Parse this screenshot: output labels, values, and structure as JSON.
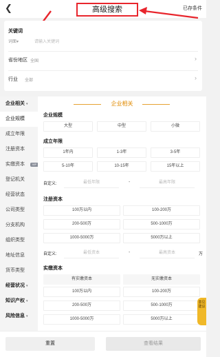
{
  "header": {
    "back_icon": "chevron-left",
    "back_glyph": "❮",
    "title": "高级搜索",
    "saved_conditions": "已存条件",
    "highlight_color": "#e8252c"
  },
  "search": {
    "keyword_label": "关键词",
    "scope": "词面",
    "scope_caret": "▾",
    "placeholder": "请输入关键词",
    "region_label": "省份地区",
    "region_value": "全国",
    "industry_label": "行业",
    "industry_value": "全部",
    "chevron": "›"
  },
  "sidebar": {
    "caret": "▾",
    "vip_badge": "VIP",
    "items": [
      {
        "label": "企业相关",
        "group": true
      },
      {
        "label": "企业规模"
      },
      {
        "label": "成立年限"
      },
      {
        "label": "注册资本"
      },
      {
        "label": "实缴资本"
      },
      {
        "label": "登记机关"
      },
      {
        "label": "经营状态"
      },
      {
        "label": "公司类型"
      },
      {
        "label": "分支机构"
      },
      {
        "label": "组织类型"
      },
      {
        "label": "地址信息"
      },
      {
        "label": "货币类型"
      },
      {
        "label": "经营状况",
        "group": true
      },
      {
        "label": "知识产权",
        "group": true
      },
      {
        "label": "风险信息",
        "group": true
      }
    ]
  },
  "content": {
    "section_title": "企业相关",
    "accent_color": "#e08a00",
    "scale": {
      "title": "企业规模",
      "options": [
        "大型",
        "中型",
        "小微"
      ]
    },
    "years": {
      "title": "成立年限",
      "options": [
        "1年内",
        "1-3年",
        "3-5年",
        "5-10年",
        "10-15年",
        "15年以上"
      ],
      "custom_label": "自定义:",
      "min_placeholder": "最低年限",
      "dash": "-",
      "max_placeholder": "最高年限"
    },
    "registered_capital": {
      "title": "注册资本",
      "options": [
        "100万以内",
        "100-200万",
        "200-500万",
        "500-1000万",
        "1000-5000万",
        "5000万以上"
      ],
      "custom_label": "自定义:",
      "min_placeholder": "最低资本",
      "dash": "-",
      "max_placeholder": "最高资本",
      "unit": "万"
    },
    "paid_capital": {
      "title": "实缴资本",
      "options": [
        "有实缴资本",
        "无实缴资本",
        "100万以内",
        "100-200万",
        "200-500万",
        "500-1000万",
        "1000-5000万",
        "5000万以上"
      ]
    }
  },
  "feedback": {
    "label": "意见建议"
  },
  "bottom": {
    "reset": "重置",
    "view_results": "查看结果"
  }
}
